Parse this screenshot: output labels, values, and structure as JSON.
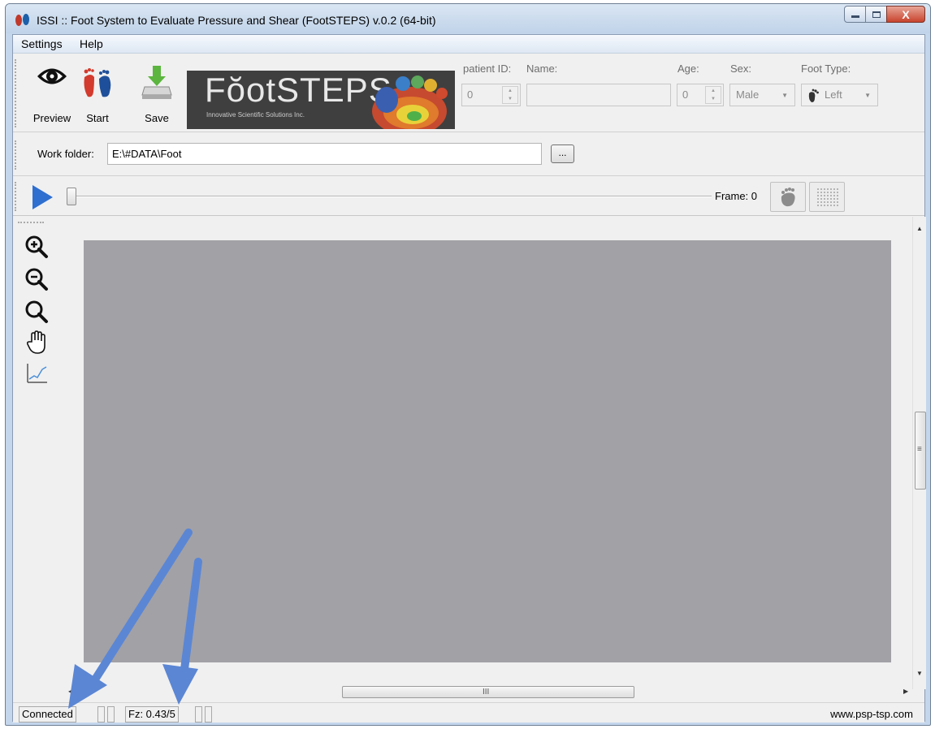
{
  "window": {
    "title": "ISSI :: Foot System to Evaluate Pressure and Shear (FootSTEPS) v.0.2 (64-bit)",
    "minimize_icon": "minimize-icon",
    "maximize_icon": "maximize-icon",
    "close_label": "X"
  },
  "menu": {
    "items": [
      "Settings",
      "Help"
    ]
  },
  "toolbar": {
    "preview_label": "Preview",
    "start_label": "Start",
    "save_label": "Save",
    "logo_title": "FŏotSTEPS",
    "logo_subtitle": "Innovative Scientific Solutions Inc."
  },
  "patient": {
    "id_label": "patient ID:",
    "id_value": "0",
    "name_label": "Name:",
    "name_value": "",
    "age_label": "Age:",
    "age_value": "0",
    "sex_label": "Sex:",
    "sex_value": "Male",
    "foot_type_label": "Foot Type:",
    "foot_type_value": "Left"
  },
  "folder": {
    "label": "Work folder:",
    "value": "E:\\#DATA\\Foot",
    "browse_label": "..."
  },
  "playback": {
    "frame_label": "Frame: 0",
    "slider_value": 0
  },
  "side_tools": [
    "zoom-in-icon",
    "zoom-out-icon",
    "zoom-fit-icon",
    "pan-hand-icon",
    "plot-chart-icon"
  ],
  "scroll": {
    "h_grip": "III",
    "v_grip": "≡"
  },
  "status": {
    "connection": "Connected",
    "force": "Fz: 0.43/5",
    "url": "www.psp-tsp.com"
  },
  "colors": {
    "accent": "#2e6fcf",
    "annotation_arrow": "#5b86d4",
    "canvas": "#a2a1a6"
  }
}
